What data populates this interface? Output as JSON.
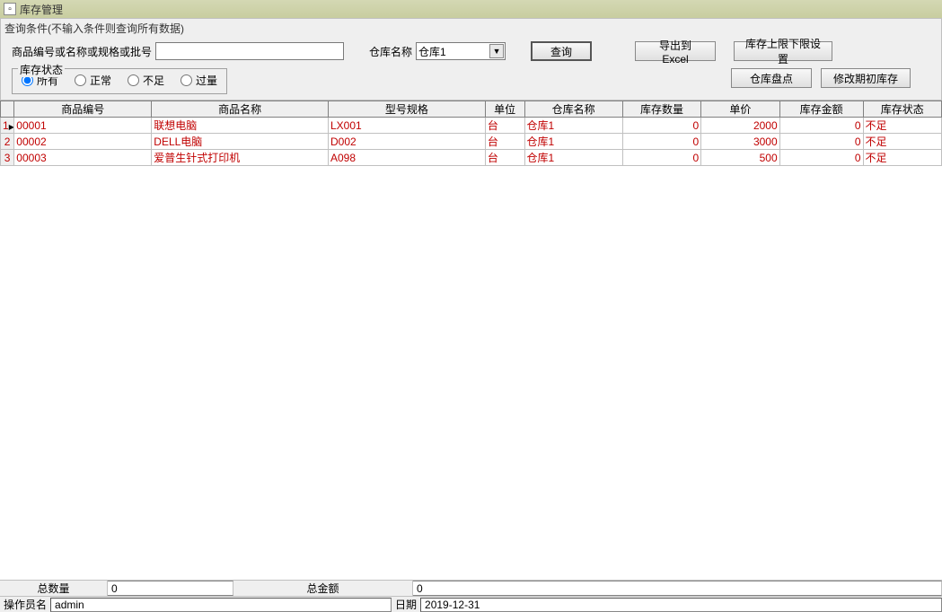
{
  "window": {
    "title": "库存管理"
  },
  "query": {
    "hint": "查询条件(不输入条件则查询所有数据)",
    "search_label": "商品编号或名称或规格或批号",
    "search_value": "",
    "warehouse_label": "仓库名称",
    "warehouse_value": "仓库1",
    "btn_query": "查询",
    "btn_export": "导出到Excel",
    "btn_limits": "库存上限下限设置",
    "stock_status_legend": "库存状态",
    "radio_all": "所有",
    "radio_normal": "正常",
    "radio_low": "不足",
    "radio_over": "过量",
    "btn_inventory": "仓库盘点",
    "btn_initstock": "修改期初库存"
  },
  "grid": {
    "headers": [
      "商品编号",
      "商品名称",
      "型号规格",
      "单位",
      "仓库名称",
      "库存数量",
      "单价",
      "库存金额",
      "库存状态"
    ],
    "rows": [
      {
        "n": "1",
        "code": "00001",
        "name": "联想电脑",
        "spec": "LX001",
        "unit": "台",
        "wh": "仓库1",
        "qty": "0",
        "price": "2000",
        "amt": "0",
        "status": "不足"
      },
      {
        "n": "2",
        "code": "00002",
        "name": "DELL电脑",
        "spec": "D002",
        "unit": "台",
        "wh": "仓库1",
        "qty": "0",
        "price": "3000",
        "amt": "0",
        "status": "不足"
      },
      {
        "n": "3",
        "code": "00003",
        "name": "爱普生针式打印机",
        "spec": "A098",
        "unit": "台",
        "wh": "仓库1",
        "qty": "0",
        "price": "500",
        "amt": "0",
        "status": "不足"
      }
    ]
  },
  "totals": {
    "qty_label": "总数量",
    "qty_value": "0",
    "amt_label": "总金额",
    "amt_value": "0"
  },
  "status": {
    "operator_label": "操作员名",
    "operator_value": "admin",
    "date_label": "日期",
    "date_value": "2019-12-31"
  }
}
